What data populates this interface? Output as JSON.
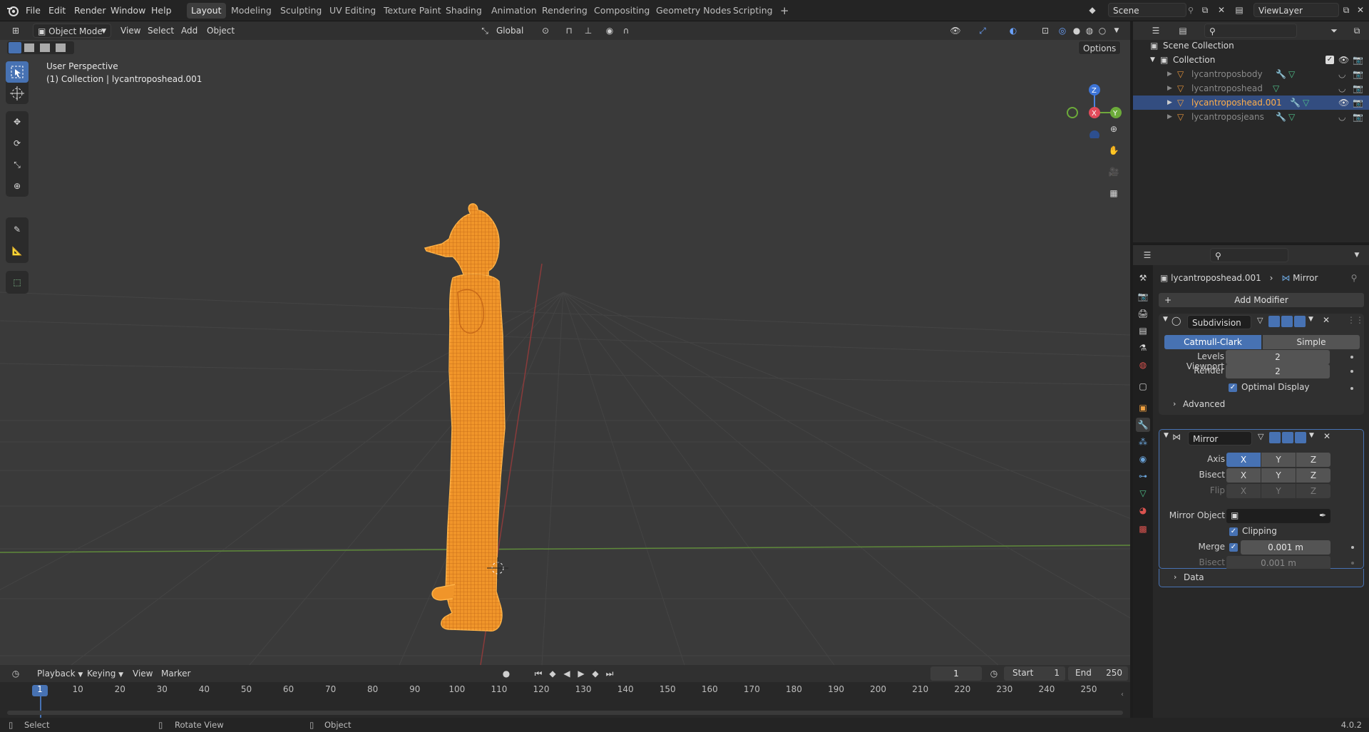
{
  "menu": {
    "file": "File",
    "edit": "Edit",
    "render": "Render",
    "window": "Window",
    "help": "Help"
  },
  "workspaces": [
    "Layout",
    "Modeling",
    "Sculpting",
    "UV Editing",
    "Texture Paint",
    "Shading",
    "Animation",
    "Rendering",
    "Compositing",
    "Geometry Nodes",
    "Scripting"
  ],
  "workspace_active": "Layout",
  "add_workspace": "+",
  "scene": "Scene",
  "view_layer": "ViewLayer",
  "viewport": {
    "mode": "Object Mode",
    "menu_view": "View",
    "menu_select": "Select",
    "menu_add": "Add",
    "menu_object": "Object",
    "transform_orientation": "Global",
    "options": "Options",
    "perspective": "User Perspective",
    "collection_info": "(1) Collection | lycantroposhead.001",
    "gizmo": {
      "x": "X",
      "y": "Y",
      "z": "Z"
    }
  },
  "outliner": {
    "scene_collection": "Scene Collection",
    "collection": "Collection",
    "objects": [
      "lycantroposbody",
      "lycantroposhead",
      "lycantroposhead.001",
      "lycantroposjeans"
    ],
    "selected": "lycantroposhead.001"
  },
  "properties": {
    "object_name": "lycantroposhead.001",
    "breadcrumb_modifier": "Mirror",
    "add_modifier": "Add Modifier",
    "subdivision": {
      "name": "Subdivision",
      "catmull": "Catmull-Clark",
      "simple": "Simple",
      "levels_viewport_label": "Levels Viewport",
      "levels_viewport": "2",
      "render_label": "Render",
      "render": "2",
      "optimal_display": "Optimal Display",
      "advanced": "Advanced"
    },
    "mirror": {
      "name": "Mirror",
      "axis_label": "Axis",
      "bisect_label": "Bisect",
      "flip_label": "Flip",
      "x": "X",
      "y": "Y",
      "z": "Z",
      "mirror_object_label": "Mirror Object",
      "clipping": "Clipping",
      "merge_label": "Merge",
      "merge": "0.001 m",
      "bisect_distance_label": "Bisect Distance",
      "bisect_distance": "0.001 m",
      "data": "Data"
    }
  },
  "timeline": {
    "playback": "Playback",
    "keying": "Keying",
    "view": "View",
    "marker": "Marker",
    "current_frame": "1",
    "start_label": "Start",
    "start": "1",
    "end_label": "End",
    "end": "250",
    "ticks": [
      "1",
      "10",
      "20",
      "30",
      "40",
      "50",
      "60",
      "70",
      "80",
      "90",
      "100",
      "110",
      "120",
      "130",
      "140",
      "150",
      "160",
      "170",
      "180",
      "190",
      "200",
      "210",
      "220",
      "230",
      "240",
      "250"
    ]
  },
  "status": {
    "select": "Select",
    "rotate": "Rotate View",
    "object": "Object",
    "version": "4.0.2"
  },
  "colors": {
    "accent": "#4772b3",
    "selection_orange": "#f5a030",
    "grid": "#464646"
  }
}
